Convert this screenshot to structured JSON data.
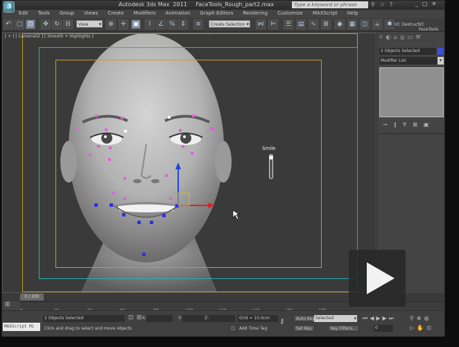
{
  "window": {
    "title": "Autodesk 3ds Max  2011     FaceTools_Rough_part2.max",
    "search_placeholder": "Type a keyword or phrase"
  },
  "menu": [
    "Edit",
    "Tools",
    "Group",
    "Views",
    "Create",
    "Modifiers",
    "Animation",
    "Graph Editors",
    "Rendering",
    "Customize",
    "MAXScript",
    "Help"
  ],
  "toolbar": {
    "view_dropdown": "View",
    "selection_set": "Create Selection Se",
    "vc_destruct": "VC Destruct",
    "vc_facetools": "VC FaceTools"
  },
  "viewport": {
    "label": "[ + ] [ Camera02 ] [ Smooth + Highlights ]",
    "slider_label": "Smile"
  },
  "command_panel": {
    "objects_selected": "2 Objects Selected",
    "modifier_list": "Modifier List"
  },
  "timeline": {
    "frame_indicator": "0 / 200",
    "ticks": [
      "0",
      "20",
      "40",
      "60",
      "80",
      "100",
      "120",
      "140",
      "160",
      "180"
    ]
  },
  "status": {
    "maxscript": "MAXScript Mi",
    "objects_selected": "2 Objects Selected",
    "prompt": "Click and drag to select and move objects",
    "x_label": "X:",
    "y_label": "Y:",
    "z_label": "Z:",
    "grid": "Grid = 10.0cm",
    "add_time_tag": "Add Time Tag",
    "auto_key": "Auto Key",
    "set_key": "Set Key",
    "selected_dropdown": "Selected",
    "key_filters": "Key Filters...",
    "frame": "0"
  },
  "colors": {
    "safe_frame_outer": "#c8a020",
    "safe_frame_title": "#1fb3b3",
    "object_color": "#3f4fd8"
  }
}
